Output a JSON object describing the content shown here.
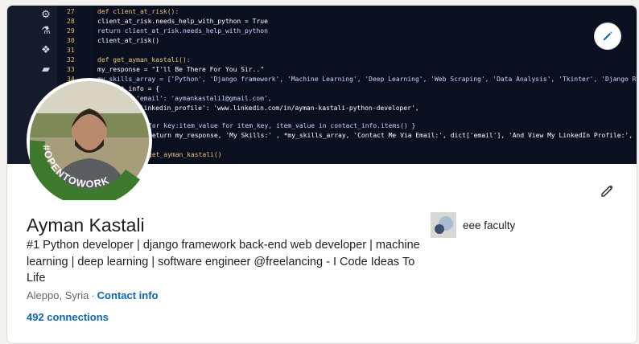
{
  "profile": {
    "name": "Ayman Kastali",
    "headline": "#1 Python developer | django framework back-end web developer | machine learning | deep learning | software engineer @freelancing - I Code Ideas To Life",
    "location": "Aleppo, Syria",
    "location_separator": "·",
    "contact_label": "Contact info",
    "connections": "492 connections",
    "open_to_work_badge": "#OPENTOWORK",
    "education": "eee faculty"
  },
  "banner": {
    "line_numbers": [
      "27",
      "28",
      "29",
      "30",
      "31",
      "32",
      "33",
      "34",
      "35"
    ],
    "code_lines": [
      "def client_at_risk():",
      "    client_at_risk.needs_help_with_python = True",
      "    return client_at_risk.needs_help_with_python",
      "client_at_risk()",
      "",
      "def get_ayman_kastali():",
      "    my_response = \"I'll Be There For You Sir..\"",
      "    my_skills_array = ['Python', 'Django framework', 'Machine Learning', 'Deep Learning', 'Web Scraping', 'Data Analysis', 'Tkinter', 'Django Rest Framework']",
      "    contact_info = {",
      "        'email': 'aymankastali1@gmail.com',",
      "        'linkedin_profile': 'www.linkedin.com/in/ayman-kastali-python-developer',",
      "    }",
      "    for key:item_value for item_key, item_value in contact_info.items() }",
      "    return my_response, 'My Skills:' , *my_skills_array, 'Contact Me Via Email:', dict['email'], 'And View My LinkedIn Profile:', dict['linkedin_profile'], sep='\\n')",
      "",
      "get_ayman_kastali()"
    ]
  },
  "colors": {
    "link": "#0a66c2",
    "open_to_work": "#3d7a2e"
  },
  "icons": {
    "edit_banner": "pencil-icon",
    "edit_intro": "pencil-icon"
  }
}
